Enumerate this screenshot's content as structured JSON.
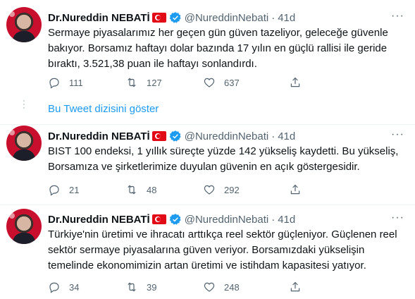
{
  "tweets": [
    {
      "name": "Dr.Nureddin NEBATİ",
      "handle": "@NureddinNebati",
      "separator": "·",
      "time": "41d",
      "lines": [
        "Sermaye piyasalarımız her geçen gün güven tazeliyor, geleceğe güvenle",
        "bakıyor. Borsamız haftayı dolar bazında 17 yılın en güçlü rallisi ile geride",
        "bıraktı, 3.521,38 puan ile haftayı sonlandırdı."
      ],
      "replies": "111",
      "retweets": "127",
      "likes": "637"
    },
    {
      "name": "Dr.Nureddin NEBATİ",
      "handle": "@NureddinNebati",
      "separator": "·",
      "time": "41d",
      "lines": [
        "BIST 100 endeksi, 1 yıllık süreçte yüzde 142 yükseliş kaydetti. Bu yükseliş,",
        "Borsamıza ve şirketlerimize duyulan güvenin en açık göstergesidir."
      ],
      "replies": "21",
      "retweets": "48",
      "likes": "292"
    },
    {
      "name": "Dr.Nureddin NEBATİ",
      "handle": "@NureddinNebati",
      "separator": "·",
      "time": "41d",
      "lines": [
        "Türkiye'nin üretimi ve ihracatı arttıkça reel sektör güçleniyor. Güçlenen reel",
        "sektör sermaye piyasalarına güven veriyor. Borsamızdaki yükselişin",
        "temelinde ekonomimizin artan üretimi ve istihdam kapasitesi yatıyor."
      ],
      "replies": "34",
      "retweets": "39",
      "likes": "248"
    }
  ],
  "thread": {
    "show_label": "Bu Tweet dizisini göster"
  },
  "icons": {
    "reply": "reply-icon",
    "retweet": "retweet-icon",
    "like": "heart-icon",
    "share": "share-icon",
    "verified": "verified-badge-icon",
    "flag": "turkish-flag-icon",
    "more": "more-options-icon"
  },
  "colors": {
    "accent": "#1d9bf0",
    "muted": "#536471",
    "flag": "#e30a17"
  }
}
